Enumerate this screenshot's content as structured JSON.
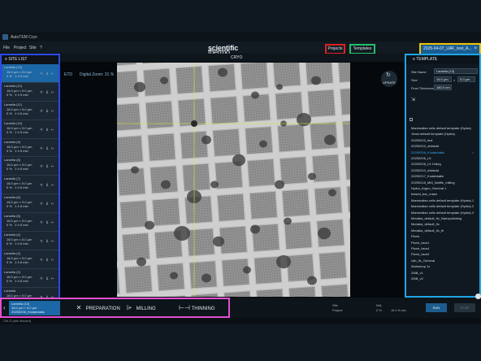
{
  "app": {
    "title": "AutoTEM Cryo",
    "menu": [
      "File",
      "Project",
      "Site",
      "?"
    ],
    "logo_a": "thermo",
    "logo_b": "scientific"
  },
  "header": {
    "projects_label": "Projects",
    "templates_label": "Templates",
    "session_tab": "2025-04-07_UAF_test_A...",
    "session_close": "×"
  },
  "sitelist": {
    "title": "SITE LIST",
    "items": [
      {
        "name": "Lamella (13)",
        "size1": "16.0 µm × 5.0 µm",
        "size2": "0 %",
        "size3": "1 h 5 min",
        "selected": true
      },
      {
        "name": "Lamella (12)",
        "size1": "16.0 µm × 5.0 µm",
        "size2": "0 %",
        "size3": "1 h 5 min",
        "selected": false
      },
      {
        "name": "Lamella (11)",
        "size1": "16.0 µm × 5.0 µm",
        "size2": "0 %",
        "size3": "1 h 5 min",
        "selected": false
      },
      {
        "name": "Lamella (10)",
        "size1": "16.0 µm × 5.0 µm",
        "size2": "0 %",
        "size3": "1 h 5 min",
        "selected": false
      },
      {
        "name": "Lamella (9)",
        "size1": "16.0 µm × 5.0 µm",
        "size2": "0 %",
        "size3": "1 h 5 min",
        "selected": false
      },
      {
        "name": "Lamella (8)",
        "size1": "16.0 µm × 5.0 µm",
        "size2": "0 %",
        "size3": "1 h 5 min",
        "selected": false
      },
      {
        "name": "Lamella (7)",
        "size1": "16.0 µm × 5.0 µm",
        "size2": "0 %",
        "size3": "1 h 5 min",
        "selected": false
      },
      {
        "name": "Lamella (6)",
        "size1": "16.0 µm × 5.0 µm",
        "size2": "0 %",
        "size3": "1 h 5 min",
        "selected": false
      },
      {
        "name": "Lamella (5)",
        "size1": "16.0 µm × 5.0 µm",
        "size2": "0 %",
        "size3": "1 h 5 min",
        "selected": false
      },
      {
        "name": "Lamella (4)",
        "size1": "16.0 µm × 5.0 µm",
        "size2": "0 %",
        "size3": "1 h 5 min",
        "selected": false
      },
      {
        "name": "Lamella (3)",
        "size1": "16.0 µm × 5.0 µm",
        "size2": "0 %",
        "size3": "1 h 5 min",
        "selected": false
      },
      {
        "name": "Lamella (2)",
        "size1": "16.0 µm × 5.0 µm",
        "size2": "0 %",
        "size3": "1 h 5 min",
        "selected": false
      },
      {
        "name": "Lamella",
        "size1": "16.0 µm × 5.0 µm",
        "size2": "0 %",
        "size3": "1 h 5 min",
        "selected": false
      }
    ]
  },
  "viewer": {
    "title": "CRYO",
    "mode": "ETD",
    "zoom": "Digital Zoom: 31 %",
    "update_label": "UPDATE"
  },
  "template": {
    "title": "TEMPLATE",
    "site_name_label": "Site Name",
    "site_name_value": "Lamella (13)",
    "size_label": "Size",
    "size_w": "16.0 µm",
    "size_x": "×",
    "size_h": "5.0 µm",
    "thickness_label": "Final Thickness",
    "thickness_value": "180.0 nm",
    "items": [
      "Mammalian cells default template (Hydra)",
      "Yeast default template (Hydra)",
      "20250203_test",
      "20250203_oblakdd",
      "20250206_Kludabáákk",
      "20250206_L5",
      "20250206_L5 10deg",
      "20250210_oblakdd",
      "20250217_Kudabáákk",
      "20250218_MM_Waffle_milling",
      "Hydra_Argon_General 1",
      "biased_bar_rnaen",
      "Mammalian cells default template (Hydra) 1",
      "Mammalian cells default template (Hydra) 2",
      "Mammalian cells default template (Hydra) 3",
      "Medaka_default_flx_Nanopolishing",
      "Medaka_default_flx",
      "Medaka_default_flx_flr",
      "Plcetr",
      "Plcetr_bsm1",
      "Plcetr_bsm4",
      "Plcetr_bsm3",
      "cdb_flx_General",
      "Workshop 1x",
      "ZMB_v1",
      "ZMB_v2"
    ],
    "highlight_index": 4
  },
  "workflow": {
    "current": {
      "name": "Lamella (13)",
      "size": "16.0 µm × 5.0 µm",
      "sub": "20250206_Kludabáákk"
    },
    "steps": [
      {
        "label": "PREPARATION",
        "glyph": "✕"
      },
      {
        "label": "MILLING",
        "glyph": "⩥"
      },
      {
        "label": "THINNING",
        "glyph": "⊢⊣"
      }
    ]
  },
  "status": {
    "site_label": "Site",
    "project_label": "Project",
    "site_value": "N/A",
    "project_value": "0 %",
    "eta": "16 h 5 min",
    "run_label": "RUN",
    "stop_label": "STOP"
  },
  "footer": {
    "text": "Ctrl-S (site discard)"
  }
}
